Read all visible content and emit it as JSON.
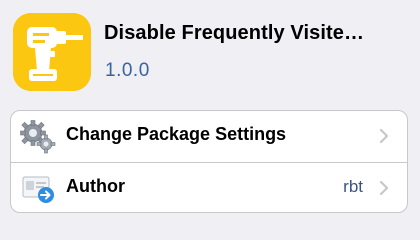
{
  "package": {
    "title": "Disable Frequently Visite…",
    "version": "1.0.0",
    "icon": "drill-icon",
    "icon_color": "#fcc711"
  },
  "rows": [
    {
      "label": "Change Package Settings",
      "value": "",
      "icon": "gears-icon"
    },
    {
      "label": "Author",
      "value": "rbt",
      "icon": "contact-card-icon"
    }
  ],
  "colors": {
    "version_text": "#39639d",
    "row_value_text": "#385487",
    "chevron": "#c7c7cc",
    "background": "#efeff4"
  }
}
